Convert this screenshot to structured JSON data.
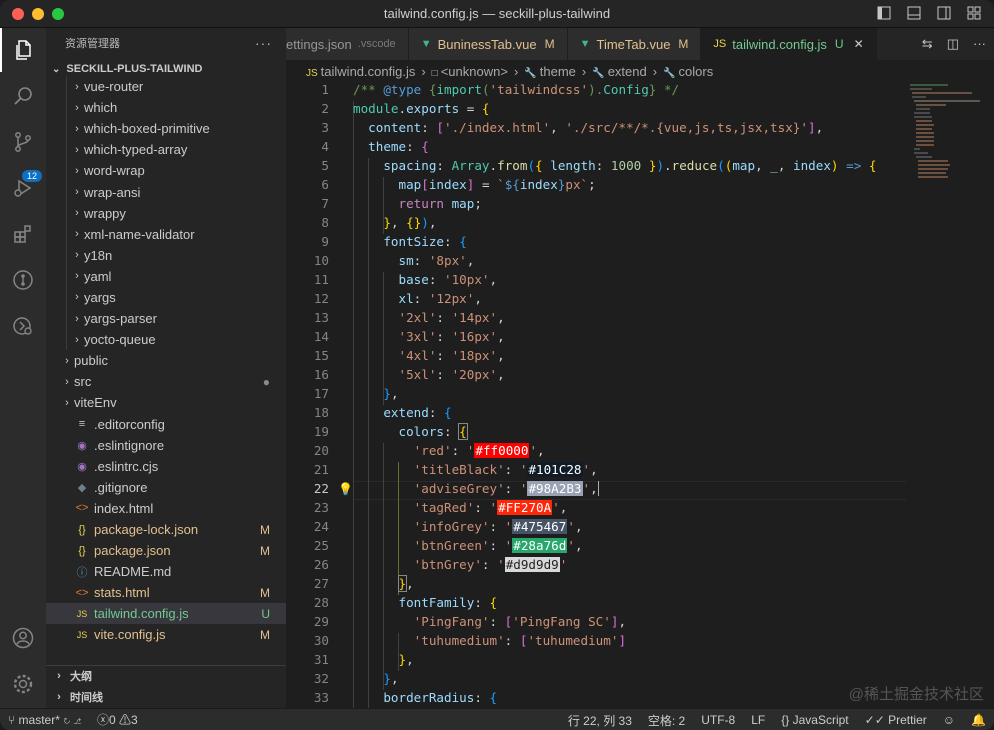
{
  "window": {
    "title": "tailwind.config.js — seckill-plus-tailwind"
  },
  "colors": {
    "accent": "#0e70c0",
    "modified": "#e2c08d",
    "untracked": "#73c991"
  },
  "activity_bar": [
    {
      "name": "explorer-icon"
    },
    {
      "name": "search-icon"
    },
    {
      "name": "source-control-icon",
      "badge": "12"
    },
    {
      "name": "run-debug-icon"
    },
    {
      "name": "extensions-icon"
    },
    {
      "name": "git-graph-icon"
    },
    {
      "name": "remote-icon"
    }
  ],
  "activity_bottom": [
    {
      "name": "account-icon"
    },
    {
      "name": "settings-gear-icon"
    }
  ],
  "sidebar": {
    "header": "资源管理器",
    "more": "···",
    "project": "SECKILL-PLUS-TAILWIND",
    "items": [
      {
        "label": "vue-router",
        "indent": 2,
        "chev": "›",
        "icon": "",
        "status": ""
      },
      {
        "label": "which",
        "indent": 2,
        "chev": "›",
        "icon": "",
        "status": ""
      },
      {
        "label": "which-boxed-primitive",
        "indent": 2,
        "chev": "›",
        "icon": "",
        "status": ""
      },
      {
        "label": "which-typed-array",
        "indent": 2,
        "chev": "›",
        "icon": "",
        "status": ""
      },
      {
        "label": "word-wrap",
        "indent": 2,
        "chev": "›",
        "icon": "",
        "status": ""
      },
      {
        "label": "wrap-ansi",
        "indent": 2,
        "chev": "›",
        "icon": "",
        "status": ""
      },
      {
        "label": "wrappy",
        "indent": 2,
        "chev": "›",
        "icon": "",
        "status": ""
      },
      {
        "label": "xml-name-validator",
        "indent": 2,
        "chev": "›",
        "icon": "",
        "status": ""
      },
      {
        "label": "y18n",
        "indent": 2,
        "chev": "›",
        "icon": "",
        "status": ""
      },
      {
        "label": "yaml",
        "indent": 2,
        "chev": "›",
        "icon": "",
        "status": ""
      },
      {
        "label": "yargs",
        "indent": 2,
        "chev": "›",
        "icon": "",
        "status": ""
      },
      {
        "label": "yargs-parser",
        "indent": 2,
        "chev": "›",
        "icon": "",
        "status": ""
      },
      {
        "label": "yocto-queue",
        "indent": 2,
        "chev": "›",
        "icon": "",
        "status": ""
      },
      {
        "label": "public",
        "indent": 1,
        "chev": "›",
        "icon": "",
        "status": ""
      },
      {
        "label": "src",
        "indent": 1,
        "chev": "›",
        "icon": "",
        "status": "●"
      },
      {
        "label": "viteEnv",
        "indent": 1,
        "chev": "›",
        "icon": "",
        "status": ""
      },
      {
        "label": ".editorconfig",
        "indent": 1,
        "chev": "",
        "icon": "≡",
        "status": ""
      },
      {
        "label": ".eslintignore",
        "indent": 1,
        "chev": "",
        "icon": "◉",
        "status": ""
      },
      {
        "label": ".eslintrc.cjs",
        "indent": 1,
        "chev": "",
        "icon": "◉",
        "status": ""
      },
      {
        "label": ".gitignore",
        "indent": 1,
        "chev": "",
        "icon": "◆",
        "status": ""
      },
      {
        "label": "index.html",
        "indent": 1,
        "chev": "",
        "icon": "<>",
        "status": ""
      },
      {
        "label": "package-lock.json",
        "indent": 1,
        "chev": "",
        "icon": "{}",
        "status": "M"
      },
      {
        "label": "package.json",
        "indent": 1,
        "chev": "",
        "icon": "{}",
        "status": "M"
      },
      {
        "label": "README.md",
        "indent": 1,
        "chev": "",
        "icon": "ⓘ",
        "status": ""
      },
      {
        "label": "stats.html",
        "indent": 1,
        "chev": "",
        "icon": "<>",
        "status": "M"
      },
      {
        "label": "tailwind.config.js",
        "indent": 1,
        "chev": "",
        "icon": "JS",
        "status": "U"
      },
      {
        "label": "vite.config.js",
        "indent": 1,
        "chev": "",
        "icon": "JS",
        "status": "M"
      }
    ],
    "selected_index": 25,
    "outline": "大纲",
    "timeline": "时间线"
  },
  "tabs": [
    {
      "label": "ettings.json",
      "hint": ".vscode",
      "icon": "",
      "mark": "",
      "active": false
    },
    {
      "label": "BuninessTab.vue",
      "hint": "",
      "icon": "▼",
      "mark": "M",
      "active": false
    },
    {
      "label": "TimeTab.vue",
      "hint": "",
      "icon": "▼",
      "mark": "M",
      "active": false
    },
    {
      "label": "tailwind.config.js",
      "hint": "",
      "icon": "JS",
      "mark": "U",
      "active": true
    }
  ],
  "breadcrumb": [
    {
      "icon": "JS",
      "label": "tailwind.config.js"
    },
    {
      "icon": "□",
      "label": "<unknown>"
    },
    {
      "icon": "🔧",
      "label": "theme"
    },
    {
      "icon": "🔧",
      "label": "extend"
    },
    {
      "icon": "🔧",
      "label": "colors"
    }
  ],
  "editor": {
    "current_line": 22,
    "line_numbers": [
      "1",
      "2",
      "3",
      "4",
      "5",
      "6",
      "7",
      "8",
      "9",
      "10",
      "11",
      "12",
      "13",
      "14",
      "15",
      "16",
      "17",
      "18",
      "19",
      "20",
      "21",
      "22",
      "23",
      "24",
      "25",
      "26",
      "27",
      "28",
      "29",
      "30",
      "31",
      "32",
      "33"
    ],
    "color_swatches": {
      "red": "#ff0000",
      "titleBlack": "#101C28",
      "adviseGrey": "#98A2B3",
      "tagRed": "#FF270A",
      "infoGrey": "#475467",
      "btnGreen": "#28a76d",
      "btnGrey": "#d9d9d9"
    }
  },
  "status_bar": {
    "branch": "master*",
    "errors": "0",
    "warnings": "3",
    "position": "行 22, 列 33",
    "spaces": "空格: 2",
    "encoding": "UTF-8",
    "eol": "LF",
    "language": "JavaScript",
    "formatter": "Prettier"
  },
  "watermark": "@稀土掘金技术社区"
}
